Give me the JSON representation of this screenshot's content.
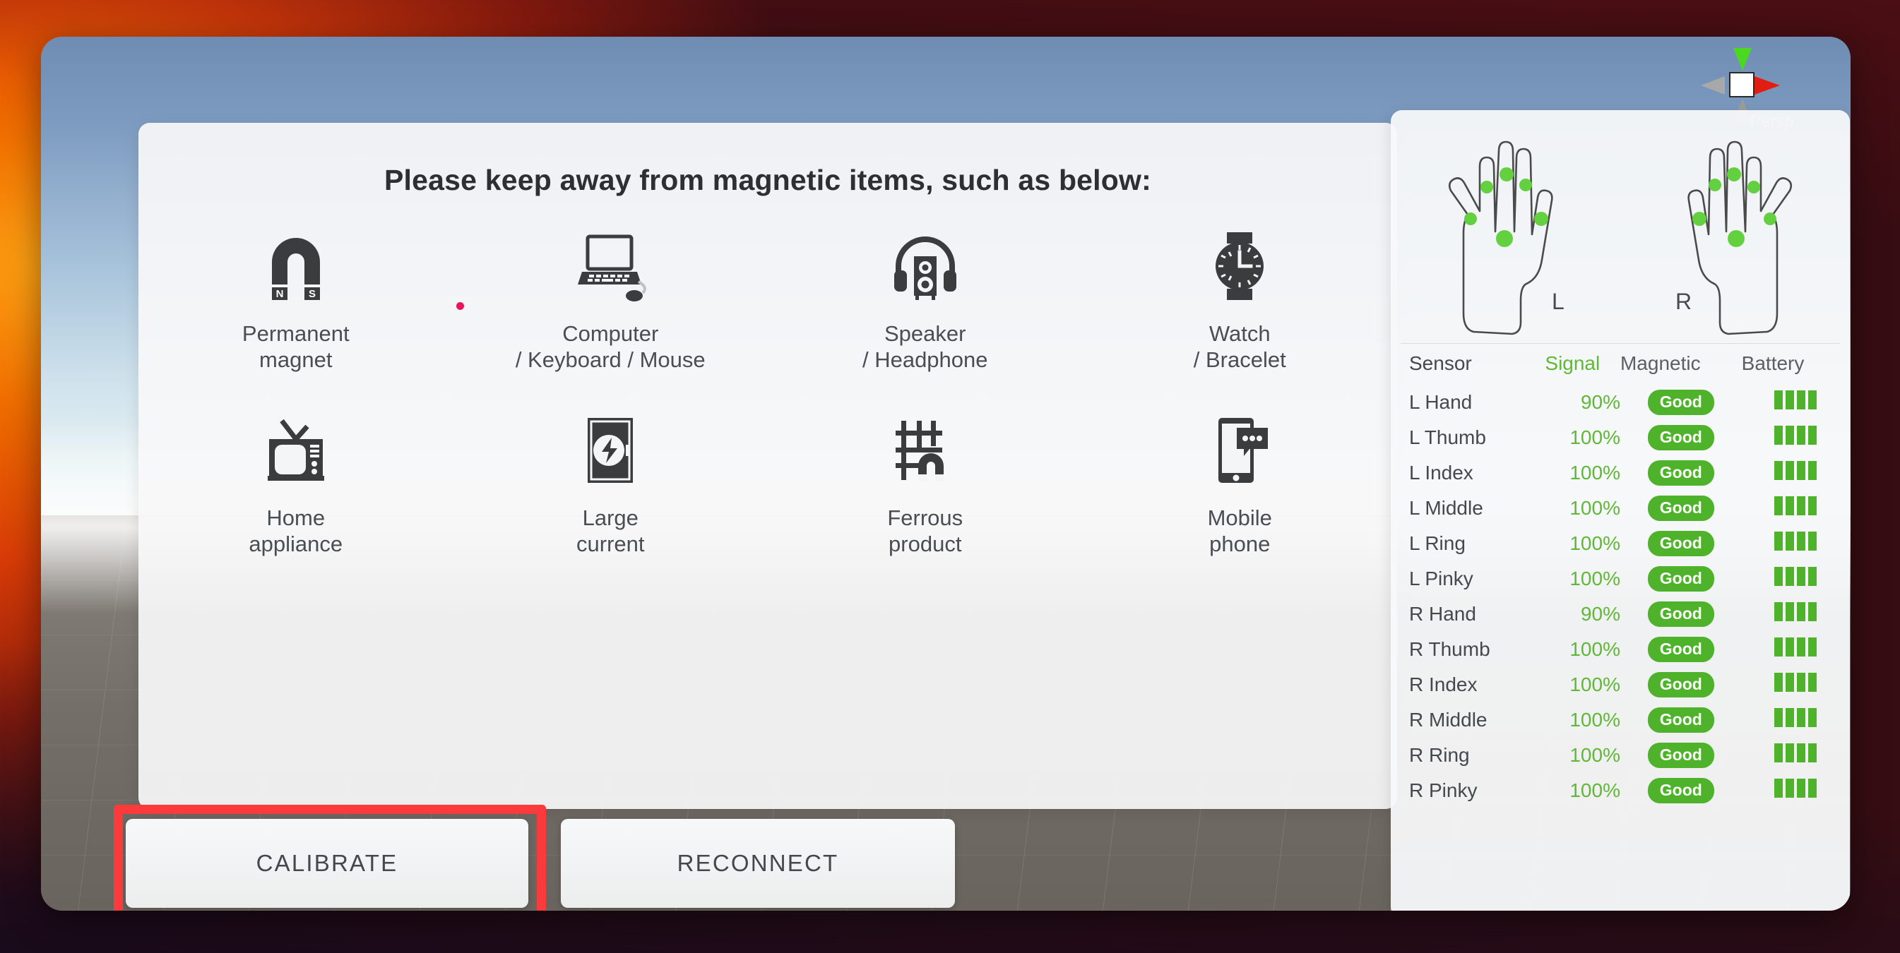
{
  "viewport": {
    "gizmo_label": "Persp",
    "axis_colors": {
      "y": "#4bd920",
      "x": "#e01f12",
      "neutral": "#9d9d9d"
    }
  },
  "card": {
    "title": "Please keep away from magnetic items, such as below:",
    "items": [
      {
        "icon": "magnet-icon",
        "line1": "Permanent",
        "line2": "magnet"
      },
      {
        "icon": "laptop-mouse-icon",
        "line1": "Computer",
        "line2": "/ Keyboard / Mouse"
      },
      {
        "icon": "speaker-headphone-icon",
        "line1": "Speaker",
        "line2": "/ Headphone"
      },
      {
        "icon": "watch-icon",
        "line1": "Watch",
        "line2": "/ Bracelet"
      },
      {
        "icon": "television-icon",
        "line1": "Home",
        "line2": "appliance"
      },
      {
        "icon": "high-current-icon",
        "line1": "Large",
        "line2": "current"
      },
      {
        "icon": "ferrous-magnet-icon",
        "line1": "Ferrous",
        "line2": "product"
      },
      {
        "icon": "mobile-phone-icon",
        "line1": "Mobile",
        "line2": "phone"
      }
    ],
    "magnet_poles": {
      "north": "N",
      "south": "S"
    }
  },
  "buttons": {
    "calibrate": "CALIBRATE",
    "reconnect": "RECONNECT",
    "highlight_color": "#fb3b3b"
  },
  "panel": {
    "hands": {
      "left_label": "L",
      "right_label": "R",
      "sensor_dot_color": "#63d13f"
    },
    "table": {
      "headers": [
        "Sensor",
        "Signal",
        "Magnetic",
        "Battery"
      ],
      "status_ok_color": "#4eb22b",
      "rows": [
        {
          "sensor": "L Hand",
          "signal": "90%",
          "magnetic": "Good",
          "battery_bars": 4
        },
        {
          "sensor": "L Thumb",
          "signal": "100%",
          "magnetic": "Good",
          "battery_bars": 4
        },
        {
          "sensor": "L Index",
          "signal": "100%",
          "magnetic": "Good",
          "battery_bars": 4
        },
        {
          "sensor": "L Middle",
          "signal": "100%",
          "magnetic": "Good",
          "battery_bars": 4
        },
        {
          "sensor": "L Ring",
          "signal": "100%",
          "magnetic": "Good",
          "battery_bars": 4
        },
        {
          "sensor": "L Pinky",
          "signal": "100%",
          "magnetic": "Good",
          "battery_bars": 4
        },
        {
          "sensor": "R Hand",
          "signal": "90%",
          "magnetic": "Good",
          "battery_bars": 4
        },
        {
          "sensor": "R Thumb",
          "signal": "100%",
          "magnetic": "Good",
          "battery_bars": 4
        },
        {
          "sensor": "R Index",
          "signal": "100%",
          "magnetic": "Good",
          "battery_bars": 4
        },
        {
          "sensor": "R Middle",
          "signal": "100%",
          "magnetic": "Good",
          "battery_bars": 4
        },
        {
          "sensor": "R Ring",
          "signal": "100%",
          "magnetic": "Good",
          "battery_bars": 4
        },
        {
          "sensor": "R Pinky",
          "signal": "100%",
          "magnetic": "Good",
          "battery_bars": 4
        }
      ]
    }
  }
}
